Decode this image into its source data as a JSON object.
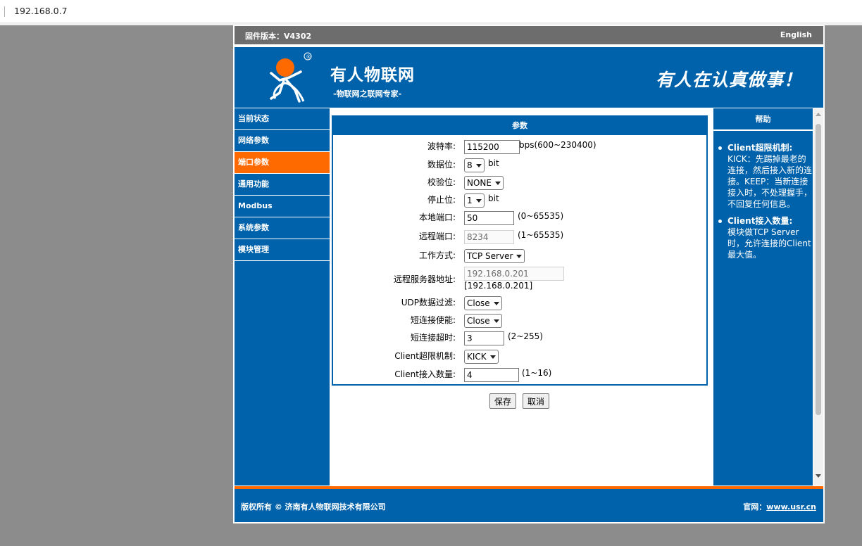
{
  "browser": {
    "url": "192.168.0.7"
  },
  "topbar": {
    "firmware": "固件版本：V4302",
    "language": "English"
  },
  "banner": {
    "company": "有人物联网",
    "tagline": "-物联网之联网专家-",
    "slogan": "有人在认真做事！",
    "logo_mark": "®"
  },
  "nav": {
    "items": [
      {
        "label": "当前状态"
      },
      {
        "label": "网络参数"
      },
      {
        "label": "端口参数"
      },
      {
        "label": "通用功能"
      },
      {
        "label": "Modbus"
      },
      {
        "label": "系统参数"
      },
      {
        "label": "模块管理"
      }
    ],
    "active_index": 2
  },
  "panel": {
    "title": "参数",
    "baud": {
      "label": "波特率:",
      "value": "115200",
      "unit": "bps(600~230400)"
    },
    "databits": {
      "label": "数据位:",
      "value": "8",
      "unit": "bit"
    },
    "parity": {
      "label": "校验位:",
      "value": "NONE"
    },
    "stopbits": {
      "label": "停止位:",
      "value": "1",
      "unit": "bit"
    },
    "local_port": {
      "label": "本地端口:",
      "value": "50",
      "unit": "(0~65535)"
    },
    "remote_port": {
      "label": "远程端口:",
      "value": "8234",
      "unit": "(1~65535)"
    },
    "work_mode": {
      "label": "工作方式:",
      "value": "TCP Server"
    },
    "remote_server": {
      "label": "远程服务器地址:",
      "value": "192.168.0.201",
      "echo": "[192.168.0.201]"
    },
    "udp_filter": {
      "label": "UDP数据过滤:",
      "value": "Close"
    },
    "short_conn": {
      "label": "短连接使能:",
      "value": "Close"
    },
    "short_timeout": {
      "label": "短连接超时:",
      "value": "3",
      "unit": "(2~255)"
    },
    "client_limit": {
      "label": "Client超限机制:",
      "value": "KICK"
    },
    "client_count": {
      "label": "Client接入数量:",
      "value": "4",
      "unit": "(1~16)"
    }
  },
  "buttons": {
    "save": "保存",
    "cancel": "取消"
  },
  "help": {
    "title": "帮助",
    "items": [
      {
        "title": "Client超限机制:",
        "body": "KICK：先踢掉最老的连接，然后接入新的连接。KEEP：当新连接接入时，不处理握手，不回复任何信息。"
      },
      {
        "title": "Client接入数量:",
        "body": "模块做TCP Server时，允许连接的Client最大值。"
      }
    ]
  },
  "footer": {
    "copyright": "版权所有 © 济南有人物联网技术有限公司",
    "site_label": "官网：",
    "site_link": "www.usr.cn"
  },
  "colors": {
    "brand_blue": "#0062aa",
    "accent_orange": "#ff6a00",
    "topbar_gray": "#6d6d6d"
  }
}
